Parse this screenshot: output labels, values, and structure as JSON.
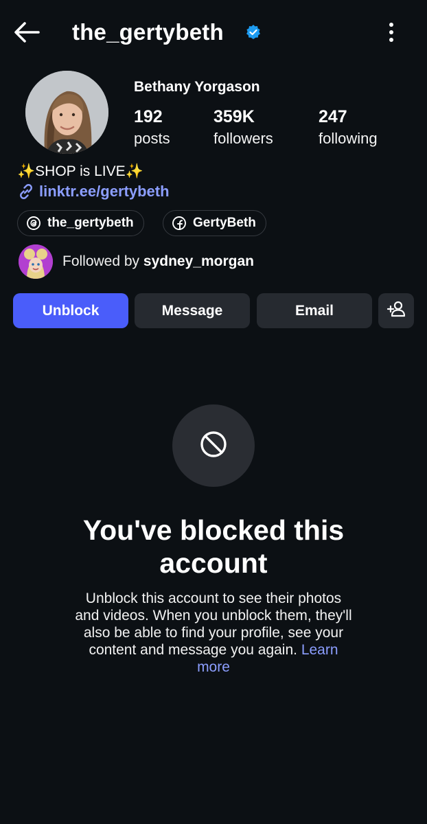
{
  "header": {
    "username": "the_gertybeth",
    "back_icon": "arrow-left-icon",
    "more_icon": "more-vertical-icon",
    "verified_icon": "verified-badge-icon"
  },
  "profile": {
    "display_name": "Bethany Yorgason",
    "stats": [
      {
        "count": "192",
        "label": "posts"
      },
      {
        "count": "359K",
        "label": "followers"
      },
      {
        "count": "247",
        "label": "following"
      }
    ],
    "bio": {
      "text": "SHOP is LIVE",
      "emoji_left": "✨",
      "emoji_right": "✨"
    },
    "link": "linktr.ee/gertybeth",
    "chips": [
      {
        "label": "the_gertybeth",
        "icon": "threads-icon"
      },
      {
        "label": "GertyBeth",
        "icon": "facebook-icon"
      }
    ],
    "followed_by": {
      "prefix": "Followed by ",
      "name": "sydney_morgan"
    }
  },
  "actions": {
    "unblock": "Unblock",
    "message": "Message",
    "email": "Email",
    "add_person_icon": "add-person-icon"
  },
  "blocked": {
    "title_line1": "You've blocked this",
    "title_line2": "account",
    "body": "Unblock this account to see their photos and videos. When you unblock them, they'll also be able to find your profile, see your content and message you again.",
    "learn_more": "Learn more"
  },
  "colors": {
    "background": "#0c1014",
    "primary_button": "#4a5dfa",
    "secondary_button": "#262a30",
    "link": "#8c9eff",
    "verified": "#1d9bf0"
  }
}
